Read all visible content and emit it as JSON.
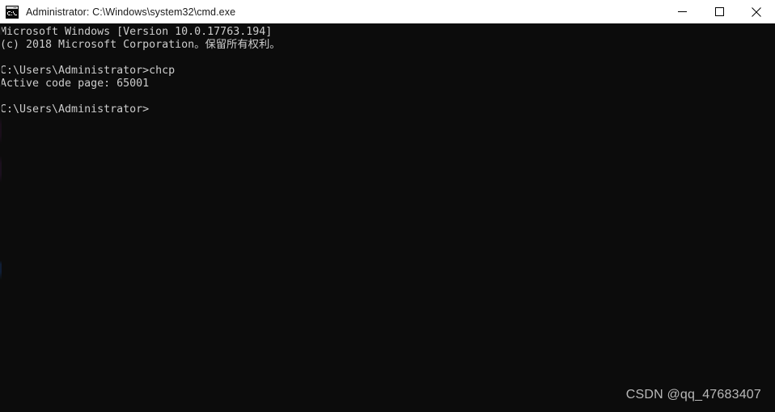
{
  "window": {
    "title": "Administrator: C:\\Windows\\system32\\cmd.exe",
    "icon": "cmd-console-icon",
    "background_color": "#0c0c0c",
    "titlebar_color": "#ffffff",
    "text_color": "#cccccc"
  },
  "titlebar_buttons": {
    "minimize_label": "—",
    "maximize_label": "□",
    "close_label": "×"
  },
  "console": {
    "lines": [
      "Microsoft Windows [Version 10.0.17763.194]",
      "(c) 2018 Microsoft Corporation。保留所有权利。",
      "",
      "C:\\Users\\Administrator>chcp",
      "Active code page: 65001",
      "",
      "C:\\Users\\Administrator>"
    ],
    "text": "Microsoft Windows [Version 10.0.17763.194]\n(c) 2018 Microsoft Corporation。保留所有权利。\n\nC:\\Users\\Administrator>chcp\nActive code page: 65001\n\nC:\\Users\\Administrator>",
    "command": "chcp",
    "code_page": "65001",
    "prompt": "C:\\Users\\Administrator>",
    "windows_version": "10.0.17763.194",
    "copyright_year": "2018"
  },
  "watermark": {
    "text": "CSDN @qq_47683407"
  }
}
